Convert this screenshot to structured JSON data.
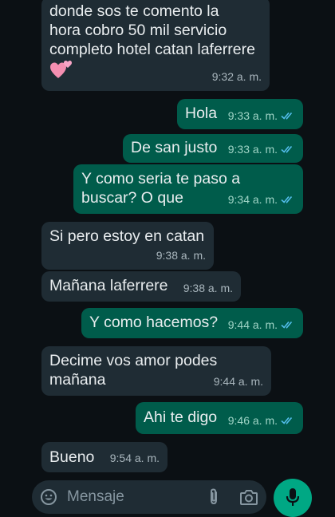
{
  "messages": [
    {
      "id": "m1",
      "dir": "in",
      "text": "donde sos te comento la\nhora cobro 50 mil servicio\ncompleto hotel catan laferrere",
      "time": "9:32 a. m.",
      "emoji": "heart"
    },
    {
      "id": "m2",
      "dir": "out",
      "text": "Hola",
      "time": "9:33 a. m.",
      "read": true
    },
    {
      "id": "m3",
      "dir": "out",
      "text": "De san justo",
      "time": "9:33 a. m.",
      "read": true
    },
    {
      "id": "m4",
      "dir": "out",
      "text": "Y como seria te paso a\nbuscar? O que",
      "time": "9:34 a. m.",
      "read": true
    },
    {
      "id": "m5",
      "dir": "in",
      "text": "Si pero estoy en catan",
      "time": "9:38 a. m."
    },
    {
      "id": "m6",
      "dir": "in",
      "text": "Mañana laferrere",
      "time": "9:38 a. m."
    },
    {
      "id": "m7",
      "dir": "out",
      "text": "Y como hacemos?",
      "time": "9:44 a. m.",
      "read": true
    },
    {
      "id": "m8",
      "dir": "in",
      "text": "Decime vos amor podes\nmañana",
      "time": "9:44 a. m."
    },
    {
      "id": "m9",
      "dir": "out",
      "text": "Ahi te digo",
      "time": "9:46 a. m.",
      "read": true
    },
    {
      "id": "m10",
      "dir": "in",
      "text": "Bueno",
      "time": "9:54 a. m."
    }
  ],
  "composer": {
    "placeholder": "Mensaje",
    "icons": [
      "emoji-icon",
      "attach-icon",
      "camera-icon",
      "mic-icon"
    ]
  },
  "colors": {
    "background": "#0b1014",
    "incoming_bubble": "#1f2c34",
    "outgoing_bubble": "#005c4b",
    "read_ticks": "#53bdeb",
    "mic_button": "#00a884"
  }
}
